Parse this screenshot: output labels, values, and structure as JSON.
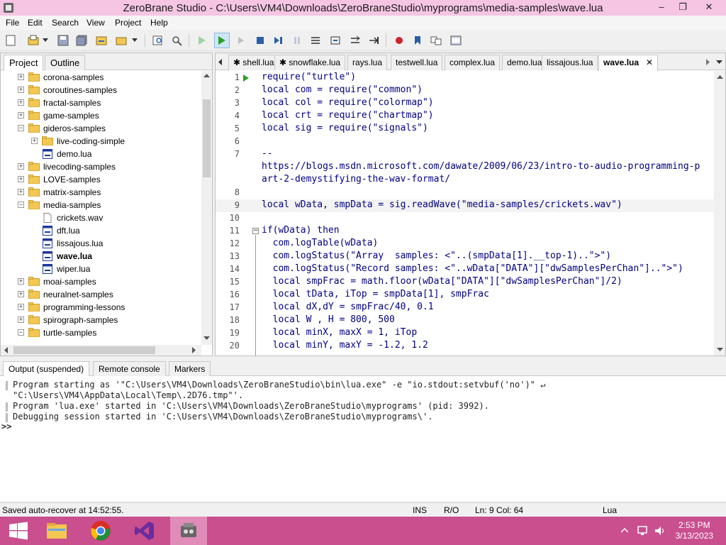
{
  "window": {
    "title": "ZeroBrane Studio - C:\\Users\\VM4\\Downloads\\ZeroBraneStudio\\myprograms\\media-samples\\wave.lua",
    "controls": [
      "–",
      "❐",
      "✕"
    ]
  },
  "menu": [
    "File",
    "Edit",
    "Search",
    "View",
    "Project",
    "Help"
  ],
  "left_tabs": [
    "Project",
    "Outline"
  ],
  "tree": [
    {
      "indent": 0,
      "type": "folder",
      "expander": "+",
      "label": "corona-samples"
    },
    {
      "indent": 0,
      "type": "folder",
      "expander": "+",
      "label": "coroutines-samples"
    },
    {
      "indent": 0,
      "type": "folder",
      "expander": "+",
      "label": "fractal-samples"
    },
    {
      "indent": 0,
      "type": "folder",
      "expander": "+",
      "label": "game-samples"
    },
    {
      "indent": 0,
      "type": "folder",
      "expander": "−",
      "label": "gideros-samples"
    },
    {
      "indent": 1,
      "type": "folder",
      "expander": "+",
      "label": "live-coding-simple"
    },
    {
      "indent": 1,
      "type": "file",
      "expander": "",
      "label": "demo.lua"
    },
    {
      "indent": 0,
      "type": "folder",
      "expander": "+",
      "label": "livecoding-samples"
    },
    {
      "indent": 0,
      "type": "folder",
      "expander": "+",
      "label": "LOVE-samples"
    },
    {
      "indent": 0,
      "type": "folder",
      "expander": "+",
      "label": "matrix-samples"
    },
    {
      "indent": 0,
      "type": "folder",
      "expander": "−",
      "label": "media-samples"
    },
    {
      "indent": 1,
      "type": "plain",
      "expander": "",
      "label": "crickets.wav"
    },
    {
      "indent": 1,
      "type": "file",
      "expander": "",
      "label": "dft.lua"
    },
    {
      "indent": 1,
      "type": "file",
      "expander": "",
      "label": "lissajous.lua"
    },
    {
      "indent": 1,
      "type": "file",
      "expander": "",
      "label": "wave.lua",
      "bold": true
    },
    {
      "indent": 1,
      "type": "file",
      "expander": "",
      "label": "wiper.lua"
    },
    {
      "indent": 0,
      "type": "folder",
      "expander": "+",
      "label": "moai-samples"
    },
    {
      "indent": 0,
      "type": "folder",
      "expander": "+",
      "label": "neuralnet-samples"
    },
    {
      "indent": 0,
      "type": "folder",
      "expander": "+",
      "label": "programming-lessons"
    },
    {
      "indent": 0,
      "type": "folder",
      "expander": "+",
      "label": "spirograph-samples"
    },
    {
      "indent": 0,
      "type": "folder",
      "expander": "−",
      "label": "turtle-samples"
    }
  ],
  "editor_tabs": [
    {
      "label": "✱ shell.lua"
    },
    {
      "label": "✱ snowflake.lua"
    },
    {
      "label": "rays.lua"
    },
    {
      "label": "testwell.lua"
    },
    {
      "label": "complex.lua"
    },
    {
      "label": "demo.lua"
    },
    {
      "label": "lissajous.lua"
    },
    {
      "label": "wave.lua",
      "active": true
    }
  ],
  "code_lines": [
    {
      "n": "1",
      "t": "require(\"turtle\")"
    },
    {
      "n": "2",
      "t": "local com = require(\"common\")"
    },
    {
      "n": "3",
      "t": "local col = require(\"colormap\")"
    },
    {
      "n": "4",
      "t": "local crt = require(\"chartmap\")"
    },
    {
      "n": "5",
      "t": "local sig = require(\"signals\")"
    },
    {
      "n": "6",
      "t": ""
    },
    {
      "n": "7",
      "t": "--"
    },
    {
      "n": "",
      "t": "https://blogs.msdn.microsoft.com/dawate/2009/06/23/intro-to-audio-programming-p"
    },
    {
      "n": "",
      "t": "art-2-demystifying-the-wav-format/"
    },
    {
      "n": "8",
      "t": ""
    },
    {
      "n": "9",
      "t": "local wData, smpData = sig.readWave(\"media-samples/crickets.wav\")",
      "current": true
    },
    {
      "n": "10",
      "t": ""
    },
    {
      "n": "11",
      "t": "if(wData) then"
    },
    {
      "n": "12",
      "t": "  com.logTable(wData)"
    },
    {
      "n": "13",
      "t": "  com.logStatus(\"Array  samples: <\"..(smpData[1].__top-1)..\">\")"
    },
    {
      "n": "14",
      "t": "  com.logStatus(\"Record samples: <\"..wData[\"DATA\"][\"dwSamplesPerChan\"]..\">\")"
    },
    {
      "n": "15",
      "t": "  local smpFrac = math.floor(wData[\"DATA\"][\"dwSamplesPerChan\"]/2)"
    },
    {
      "n": "16",
      "t": "  local tData, iTop = smpData[1], smpFrac"
    },
    {
      "n": "17",
      "t": "  local dX,dY = smpFrac/40, 0.1"
    },
    {
      "n": "18",
      "t": "  local W , H = 800, 500"
    },
    {
      "n": "19",
      "t": "  local minX, maxX = 1, iTop"
    },
    {
      "n": "20",
      "t": "  local minY, maxY = -1.2, 1.2"
    }
  ],
  "bottom_tabs": [
    "Output (suspended)",
    "Remote console",
    "Markers"
  ],
  "output_lines": [
    "Program starting as '\"C:\\Users\\VM4\\Downloads\\ZeroBraneStudio\\bin\\lua.exe\" -e \"io.stdout:setvbuf('no')\" ↵",
    "\"C:\\Users\\VM4\\AppData\\Local\\Temp\\.2D76.tmp\"'.",
    "Program 'lua.exe' started in 'C:\\Users\\VM4\\Downloads\\ZeroBraneStudio\\myprograms' (pid: 3992).",
    "Debugging session started in 'C:\\Users\\VM4\\Downloads\\ZeroBraneStudio\\myprograms\\'."
  ],
  "prompt": ">>",
  "status": {
    "message": "Saved auto-recover at 14:52:55.",
    "ins": "INS",
    "ro": "R/O",
    "position": "Ln: 9 Col: 64",
    "language": "Lua"
  },
  "taskbar": {
    "time": "2:53 PM",
    "date": "3/13/2023"
  },
  "colors": {
    "titlebar": "#f5c5e3",
    "taskbar": "#c94f8f",
    "keyword": "#000080",
    "string": "#7f007f",
    "folder": "#f3c751"
  }
}
